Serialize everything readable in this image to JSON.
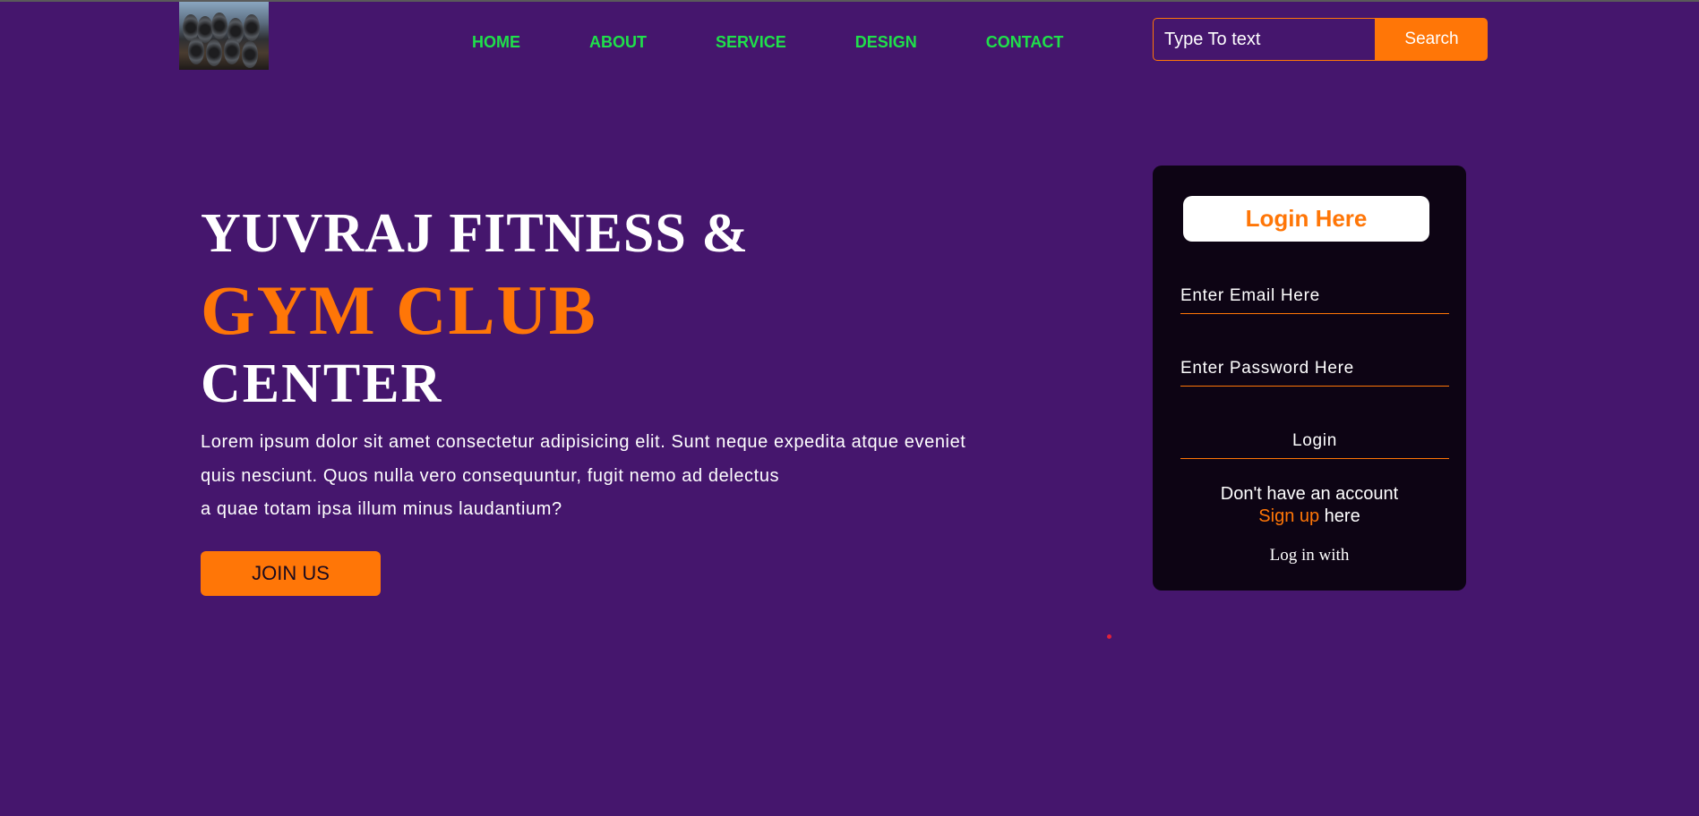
{
  "brand": {
    "logo_icon": "dumbbell-rack-image"
  },
  "nav": {
    "items": [
      {
        "label": "HOME"
      },
      {
        "label": "ABOUT"
      },
      {
        "label": "SERVICE"
      },
      {
        "label": "DESIGN"
      },
      {
        "label": "CONTACT"
      }
    ]
  },
  "search": {
    "placeholder": "Type To text",
    "button_label": "Search"
  },
  "hero": {
    "title_line1": "YUVRAJ FITNESS &",
    "title_line2": "GYM CLUB",
    "title_line3": "CENTER",
    "description_line1": "Lorem ipsum dolor sit amet consectetur adipisicing elit. Sunt neque expedita atque eveniet",
    "description_line2": "quis nesciunt. Quos nulla vero consequuntur, fugit nemo ad delectus",
    "description_line3": "a quae totam ipsa illum minus laudantium?",
    "join_label": "JOIN US"
  },
  "login": {
    "heading": "Login Here",
    "email_placeholder": "Enter Email Here",
    "password_placeholder": "Enter Password Here",
    "login_label": "Login",
    "no_account_text": "Don't have an account",
    "signup_link": "Sign up",
    "signup_suffix": " here",
    "log_in_with": "Log in with"
  },
  "colors": {
    "background": "#45166d",
    "accent": "#ff7607",
    "nav_link": "#1fe14a",
    "card": "#0d0414"
  }
}
